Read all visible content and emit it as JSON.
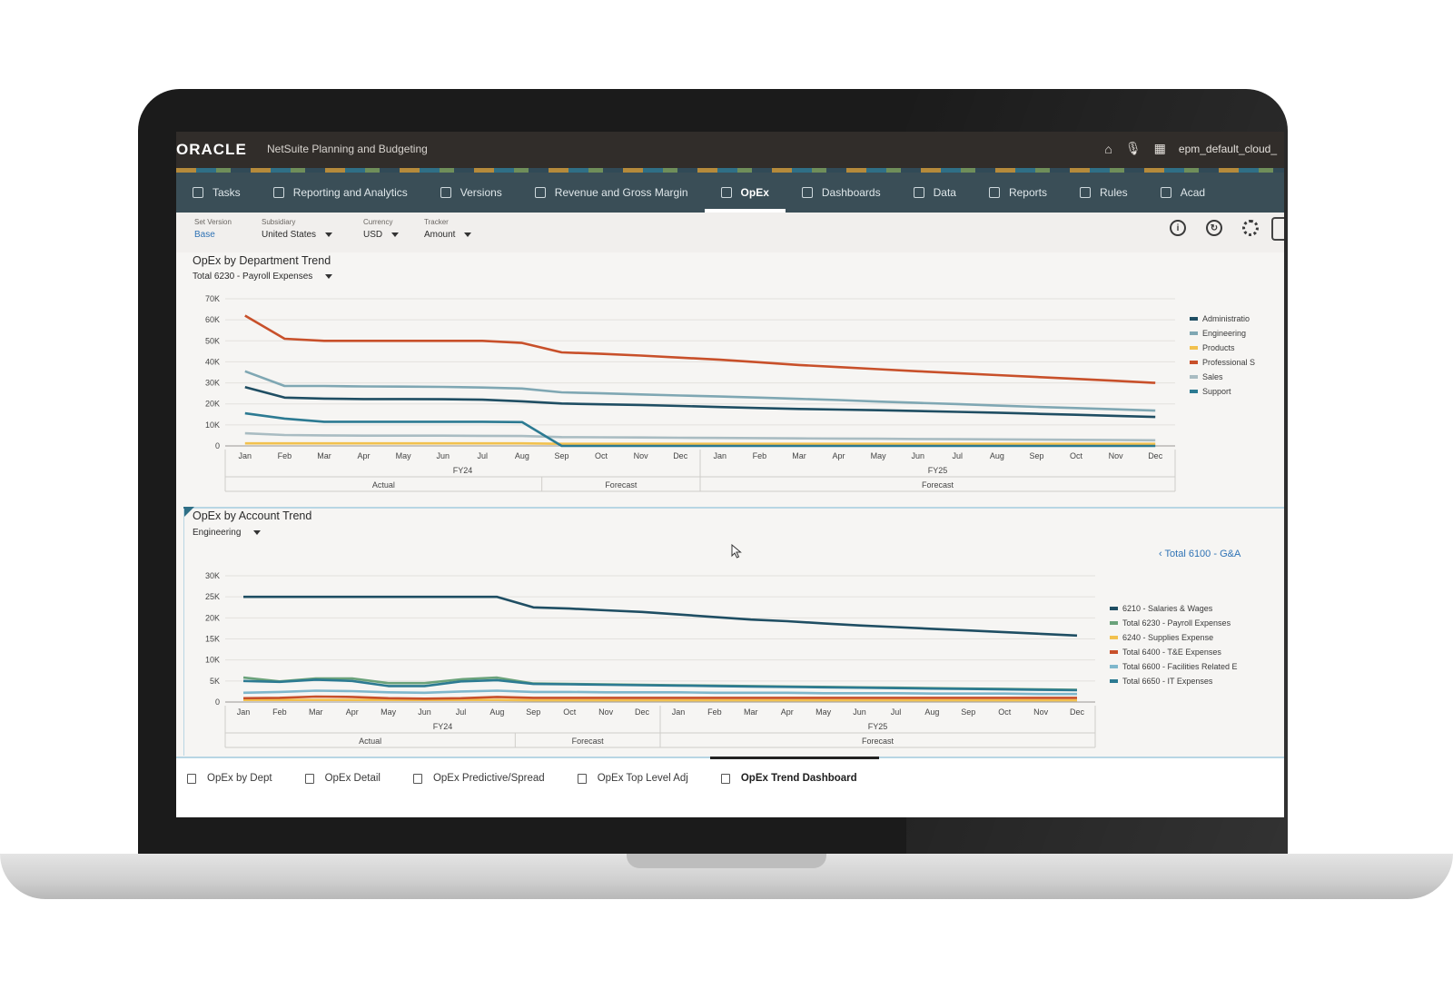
{
  "topbar": {
    "logo": "ORACLE",
    "app_title": "NetSuite Planning and Budgeting",
    "user": "epm_default_cloud_",
    "icons": [
      "home-icon",
      "microphone-icon",
      "grid-icon"
    ]
  },
  "nav": {
    "items": [
      {
        "label": "Tasks",
        "icon": "tasks-icon"
      },
      {
        "label": "Reporting and Analytics",
        "icon": "reporting-icon"
      },
      {
        "label": "Versions",
        "icon": "versions-icon"
      },
      {
        "label": "Revenue and Gross Margin",
        "icon": "revenue-icon"
      },
      {
        "label": "OpEx",
        "icon": "opex-icon",
        "active": true
      },
      {
        "label": "Dashboards",
        "icon": "dashboards-icon"
      },
      {
        "label": "Data",
        "icon": "data-icon"
      },
      {
        "label": "Reports",
        "icon": "reports-icon"
      },
      {
        "label": "Rules",
        "icon": "rules-icon"
      },
      {
        "label": "Acad",
        "icon": "academy-icon"
      }
    ]
  },
  "filters": {
    "set_version": {
      "label": "Set Version",
      "value": "Base"
    },
    "subsidiary": {
      "label": "Subsidiary",
      "value": "United States"
    },
    "currency": {
      "label": "Currency",
      "value": "USD"
    },
    "tracker": {
      "label": "Tracker",
      "value": "Amount"
    }
  },
  "toolbar": {
    "info_glyph": "i",
    "icons": [
      "info-icon",
      "refresh-icon",
      "settings-icon"
    ]
  },
  "chart1": {
    "title": "OpEx by Department Trend",
    "selector": "Total 6230 - Payroll Expenses"
  },
  "chart2": {
    "title": "OpEx by Account Trend",
    "selector": "Engineering",
    "drill_link": "Total 6100 - G&A"
  },
  "bottom_tabs": [
    {
      "label": "OpEx by Dept"
    },
    {
      "label": "OpEx Detail"
    },
    {
      "label": "OpEx Predictive/Spread"
    },
    {
      "label": "OpEx Top Level Adj"
    },
    {
      "label": "OpEx Trend Dashboard",
      "active": true
    }
  ],
  "chart_data": [
    {
      "type": "line",
      "title": "OpEx by Department Trend",
      "categories": [
        "Jan",
        "Feb",
        "Mar",
        "Apr",
        "May",
        "Jun",
        "Jul",
        "Aug",
        "Sep",
        "Oct",
        "Nov",
        "Dec",
        "Jan",
        "Feb",
        "Mar",
        "Apr",
        "May",
        "Jun",
        "Jul",
        "Aug",
        "Sep",
        "Oct",
        "Nov",
        "Dec"
      ],
      "groups": {
        "years": [
          {
            "label": "FY24",
            "span": 12
          },
          {
            "label": "FY25",
            "span": 12
          }
        ],
        "scenarios": [
          {
            "label": "Actual",
            "span": 8
          },
          {
            "label": "Forecast",
            "span": 4
          },
          {
            "label": "Forecast",
            "span": 12
          }
        ]
      },
      "ylim": [
        0,
        70000
      ],
      "yticks": [
        0,
        10000,
        20000,
        30000,
        40000,
        50000,
        60000,
        70000
      ],
      "ytick_labels": [
        "0",
        "10K",
        "20K",
        "30K",
        "40K",
        "50K",
        "60K",
        "70K"
      ],
      "grid": true,
      "legend": "right",
      "series": [
        {
          "name": "Administratio",
          "color": "#1f4e63",
          "values": [
            28000,
            23000,
            22500,
            22300,
            22300,
            22200,
            22000,
            21200,
            20200,
            19800,
            19500,
            19000,
            18500,
            18000,
            17600,
            17300,
            17000,
            16600,
            16200,
            15800,
            15300,
            14800,
            14300,
            13800
          ]
        },
        {
          "name": "Engineering",
          "color": "#7fa7b3",
          "values": [
            35500,
            28500,
            28500,
            28300,
            28200,
            28100,
            27800,
            27300,
            25500,
            25000,
            24500,
            24000,
            23500,
            23000,
            22400,
            21800,
            21100,
            20500,
            19900,
            19200,
            18600,
            18000,
            17400,
            16800
          ]
        },
        {
          "name": "Products",
          "color": "#f2c14e",
          "values": [
            1200,
            1200,
            1200,
            1200,
            1200,
            1200,
            1200,
            1200,
            1000,
            1000,
            1000,
            1000,
            1000,
            1000,
            1000,
            1000,
            1000,
            1000,
            1000,
            1000,
            1000,
            1000,
            1000,
            1000
          ]
        },
        {
          "name": "Professional S",
          "color": "#c8502a",
          "values": [
            62000,
            51000,
            50000,
            50000,
            50000,
            50000,
            50000,
            49000,
            44500,
            43800,
            43000,
            42000,
            41000,
            39800,
            38500,
            37500,
            36500,
            35500,
            34600,
            33700,
            32800,
            31900,
            31000,
            30000
          ]
        },
        {
          "name": "Sales",
          "color": "#a9bcc2",
          "values": [
            6000,
            5200,
            5000,
            4900,
            4900,
            4900,
            4800,
            4700,
            4200,
            4100,
            4000,
            3900,
            3800,
            3700,
            3600,
            3500,
            3400,
            3300,
            3200,
            3100,
            3000,
            2900,
            2800,
            2700
          ]
        },
        {
          "name": "Support",
          "color": "#2c7a92",
          "values": [
            15500,
            13000,
            11500,
            11500,
            11500,
            11500,
            11500,
            11300,
            0,
            0,
            0,
            0,
            0,
            0,
            0,
            0,
            0,
            0,
            0,
            0,
            0,
            0,
            0,
            0
          ]
        }
      ]
    },
    {
      "type": "line",
      "title": "OpEx by Account Trend",
      "categories": [
        "Jan",
        "Feb",
        "Mar",
        "Apr",
        "May",
        "Jun",
        "Jul",
        "Aug",
        "Sep",
        "Oct",
        "Nov",
        "Dec",
        "Jan",
        "Feb",
        "Mar",
        "Apr",
        "May",
        "Jun",
        "Jul",
        "Aug",
        "Sep",
        "Oct",
        "Nov",
        "Dec"
      ],
      "groups": {
        "years": [
          {
            "label": "FY24",
            "span": 12
          },
          {
            "label": "FY25",
            "span": 12
          }
        ],
        "scenarios": [
          {
            "label": "Actual",
            "span": 8
          },
          {
            "label": "Forecast",
            "span": 4
          },
          {
            "label": "Forecast",
            "span": 12
          }
        ]
      },
      "ylim": [
        0,
        30000
      ],
      "yticks": [
        0,
        5000,
        10000,
        15000,
        20000,
        25000,
        30000
      ],
      "ytick_labels": [
        "0",
        "5K",
        "10K",
        "15K",
        "20K",
        "25K",
        "30K"
      ],
      "grid": true,
      "legend": "right",
      "series": [
        {
          "name": "6210 - Salaries & Wages",
          "color": "#1f4e63",
          "values": [
            25000,
            25000,
            25000,
            25000,
            25000,
            25000,
            25000,
            25000,
            22500,
            22200,
            21800,
            21400,
            20800,
            20200,
            19600,
            19200,
            18700,
            18200,
            17800,
            17400,
            17000,
            16600,
            16200,
            15800
          ]
        },
        {
          "name": "Total 6230 - Payroll Expenses",
          "color": "#6aa27a",
          "values": [
            5800,
            4900,
            5600,
            5600,
            4500,
            4500,
            5400,
            5800,
            4400,
            4300,
            4200,
            4100,
            4000,
            3900,
            3800,
            3700,
            3600,
            3500,
            3400,
            3300,
            3200,
            3100,
            3000,
            2900
          ]
        },
        {
          "name": "6240 - Supplies Expense",
          "color": "#f2c14e",
          "values": [
            500,
            500,
            500,
            500,
            500,
            500,
            500,
            500,
            400,
            400,
            400,
            400,
            400,
            400,
            400,
            400,
            400,
            400,
            400,
            400,
            400,
            400,
            400,
            400
          ]
        },
        {
          "name": "Total 6400 - T&E Expenses",
          "color": "#c8502a",
          "values": [
            900,
            1000,
            1300,
            1200,
            900,
            800,
            900,
            1200,
            1000,
            1000,
            1000,
            1000,
            1000,
            1000,
            1000,
            1000,
            1000,
            1000,
            1000,
            1000,
            1000,
            1000,
            1000,
            1000
          ]
        },
        {
          "name": "Total 6600 - Facilities Related E",
          "color": "#7fb7cc",
          "values": [
            2200,
            2400,
            2700,
            2600,
            2300,
            2200,
            2500,
            2700,
            2400,
            2400,
            2300,
            2300,
            2300,
            2200,
            2200,
            2200,
            2100,
            2100,
            2100,
            2000,
            2000,
            2000,
            1900,
            1900
          ]
        },
        {
          "name": "Total 6650 - IT Expenses",
          "color": "#2c7a92",
          "values": [
            5000,
            4800,
            5300,
            5000,
            3800,
            3800,
            4900,
            5200,
            4300,
            4200,
            4100,
            4000,
            3900,
            3800,
            3700,
            3600,
            3500,
            3400,
            3300,
            3200,
            3100,
            3000,
            2900,
            2800
          ]
        }
      ]
    }
  ]
}
